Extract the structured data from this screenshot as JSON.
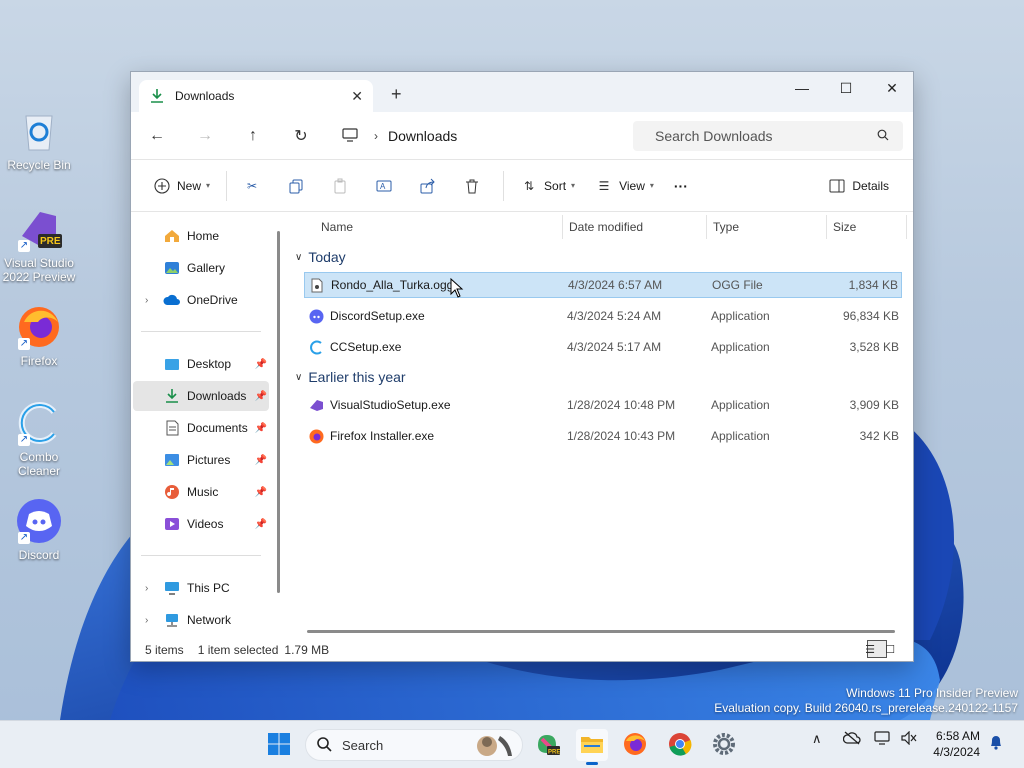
{
  "desktop": {
    "icons": [
      {
        "label": "Recycle Bin",
        "icon": "recycle-bin-icon"
      },
      {
        "label": "Visual Studio 2022 Preview",
        "icon": "visual-studio-icon",
        "badge": "PRE"
      },
      {
        "label": "Firefox",
        "icon": "firefox-icon"
      },
      {
        "label": "Combo Cleaner",
        "icon": "combo-cleaner-icon"
      },
      {
        "label": "Discord",
        "icon": "discord-icon"
      }
    ]
  },
  "window": {
    "tab_title": "Downloads",
    "tab_close": "✕",
    "new_tab": "+",
    "controls": {
      "minimize": "—",
      "maximize": "☐",
      "close": "✕"
    },
    "breadcrumb": [
      "Downloads"
    ],
    "search_placeholder": "Search Downloads",
    "toolbar": {
      "new_label": "New",
      "sort_label": "Sort",
      "view_label": "View",
      "more_label": "···",
      "details_label": "Details"
    },
    "nav": {
      "items": [
        {
          "label": "Home",
          "icon": "home-icon"
        },
        {
          "label": "Gallery",
          "icon": "gallery-icon"
        },
        {
          "label": "OneDrive",
          "icon": "onedrive-icon"
        },
        {
          "label": "Desktop",
          "icon": "desktop-folder-icon"
        },
        {
          "label": "Downloads",
          "icon": "downloads-icon"
        },
        {
          "label": "Documents",
          "icon": "documents-icon"
        },
        {
          "label": "Pictures",
          "icon": "pictures-icon"
        },
        {
          "label": "Music",
          "icon": "music-icon"
        },
        {
          "label": "Videos",
          "icon": "videos-icon"
        },
        {
          "label": "This PC",
          "icon": "this-pc-icon"
        },
        {
          "label": "Network",
          "icon": "network-icon"
        }
      ]
    },
    "columns": {
      "name": "Name",
      "date": "Date modified",
      "type": "Type",
      "size": "Size"
    },
    "groups": [
      {
        "label": "Today",
        "files": [
          {
            "name": "Rondo_Alla_Turka.ogg",
            "date": "4/3/2024 6:57 AM",
            "type": "OGG File",
            "size": "1,834 KB",
            "icon": "audio-file-icon"
          },
          {
            "name": "DiscordSetup.exe",
            "date": "4/3/2024 5:24 AM",
            "type": "Application",
            "size": "96,834 KB",
            "icon": "discord-installer-icon"
          },
          {
            "name": "CCSetup.exe",
            "date": "4/3/2024 5:17 AM",
            "type": "Application",
            "size": "3,528 KB",
            "icon": "ccleaner-installer-icon"
          }
        ]
      },
      {
        "label": "Earlier this year",
        "files": [
          {
            "name": "VisualStudioSetup.exe",
            "date": "1/28/2024 10:48 PM",
            "type": "Application",
            "size": "3,909 KB",
            "icon": "visual-studio-installer-icon"
          },
          {
            "name": "Firefox Installer.exe",
            "date": "1/28/2024 10:43 PM",
            "type": "Application",
            "size": "342 KB",
            "icon": "firefox-installer-icon"
          }
        ]
      }
    ],
    "status": {
      "count": "5 items",
      "selected": "1 item selected",
      "size": "1.79 MB"
    }
  },
  "watermark": {
    "line1": "Windows 11 Pro Insider Preview",
    "line2": "Evaluation copy. Build 26040.rs_prerelease.240122-1157"
  },
  "taskbar": {
    "search_label": "Search",
    "time": "6:58 AM",
    "date": "4/3/2024"
  },
  "colors": {
    "accent": "#0a63c9",
    "selection": "#cce4f7",
    "download_green": "#1a8f4a"
  }
}
